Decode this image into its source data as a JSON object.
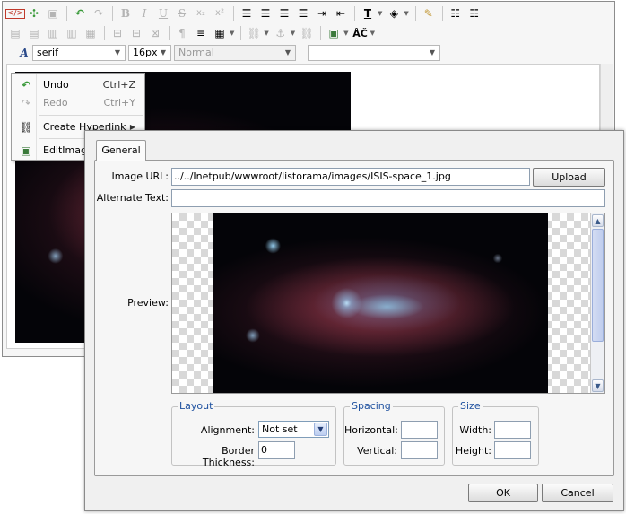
{
  "toolbar": {
    "row1": [
      "source-icon",
      "fullscreen-icon",
      "save-icon",
      "undo-icon",
      "redo-icon",
      "bold-icon",
      "italic-icon",
      "underline-icon",
      "strikethrough-icon",
      "subscript-icon",
      "superscript-icon",
      "align-left-icon",
      "align-center-icon",
      "align-justify-icon",
      "align-right-icon",
      "indent-icon",
      "outdent-icon",
      "font-color-icon",
      "highlight-color-icon",
      "clear-format-icon",
      "bullet-list-icon",
      "numbered-list-icon"
    ],
    "font_family": "serif",
    "font_size": "16px",
    "paragraph_style": "Normal",
    "extra_select": ""
  },
  "context_menu": {
    "items": [
      {
        "label": "Undo",
        "shortcut": "Ctrl+Z",
        "icon": "undo-icon",
        "enabled": true
      },
      {
        "label": "Redo",
        "shortcut": "Ctrl+Y",
        "icon": "redo-icon",
        "enabled": false
      },
      {
        "label": "Create Hyperlink",
        "shortcut": "",
        "icon": "hyperlink-icon",
        "enabled": true
      },
      {
        "label": "EditImage",
        "shortcut": "",
        "icon": "image-icon",
        "enabled": true
      }
    ]
  },
  "dialog": {
    "tab": "General",
    "image_url_label": "Image URL:",
    "image_url_value": "../../Inetpub/wwwroot/listorama/images/ISIS-space_1.jpg",
    "upload_label": "Upload",
    "alt_text_label": "Alternate Text:",
    "alt_text_value": "",
    "preview_label": "Preview:",
    "layout": {
      "legend": "Layout",
      "alignment_label": "Alignment:",
      "alignment_value": "Not set",
      "border_label": "Border Thickness:",
      "border_value": "0"
    },
    "spacing": {
      "legend": "Spacing",
      "horizontal_label": "Horizontal:",
      "horizontal_value": "",
      "vertical_label": "Vertical:",
      "vertical_value": ""
    },
    "size": {
      "legend": "Size",
      "width_label": "Width:",
      "width_value": "",
      "height_label": "Height:",
      "height_value": ""
    },
    "ok_label": "OK",
    "cancel_label": "Cancel"
  },
  "colors": {
    "accent": "#2153a0",
    "toolbar_bg": "#f6f6f6",
    "dialog_bg": "#f0f0f0"
  }
}
